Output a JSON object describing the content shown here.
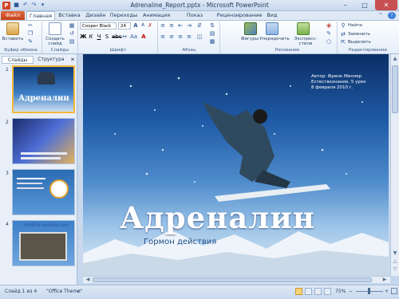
{
  "window": {
    "title": "Adrenaline_Report.pptx - Microsoft PowerPoint",
    "app_icon": "P"
  },
  "qat": {
    "save_icon": "save-icon",
    "undo_icon": "undo-icon",
    "redo_icon": "redo-icon"
  },
  "tabs": [
    {
      "label": "Файл"
    },
    {
      "label": "Главная"
    },
    {
      "label": "Вставка"
    },
    {
      "label": "Дизайн"
    },
    {
      "label": "Переходы"
    },
    {
      "label": "Анимация"
    },
    {
      "label": "Показ слайдов"
    },
    {
      "label": "Рецензирование"
    },
    {
      "label": "Вид"
    }
  ],
  "ribbon": {
    "paste_label": "Вставить",
    "create_slide_label": "Создать слайд",
    "font_name": "Cooper Black",
    "font_size": "24",
    "shapes_label": "Фигуры",
    "arrange_label": "Упорядочить",
    "styles_label": "Экспресс-стили",
    "find_label": "Найти",
    "replace_label": "Заменить",
    "select_label": "Выделить",
    "groups": {
      "clipboard": "Буфер обмена",
      "slides": "Слайды",
      "font": "Шрифт",
      "paragraph": "Абзац",
      "drawing": "Рисование",
      "editing": "Редактирование"
    }
  },
  "panel": {
    "tab_slides": "Слайды",
    "tab_outline": "Структура",
    "thumbs": [
      {
        "num": "1",
        "title": "Адреналин"
      },
      {
        "num": "2"
      },
      {
        "num": "3"
      },
      {
        "num": "4"
      }
    ],
    "watermark": "mobile-review.com"
  },
  "slide": {
    "author_lines": [
      "Автор: Френк Миллер",
      "Естествознание, 5 урок",
      "8 февраля 2010 г."
    ],
    "title": "Адреналин",
    "subtitle": "Гормон действия"
  },
  "status": {
    "slide_info": "Слайд 1 из 4",
    "theme": "\"Office Theme\"",
    "zoom": "75%"
  }
}
